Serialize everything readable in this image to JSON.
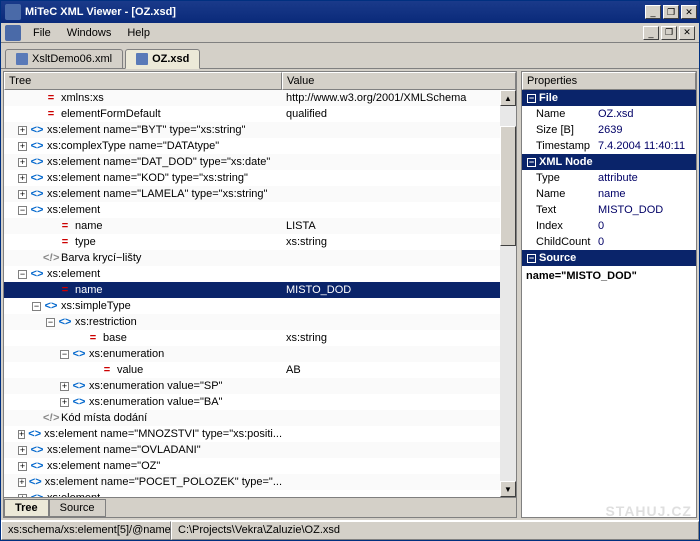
{
  "title": "MiTeC XML Viewer - [OZ.xsd]",
  "menu": {
    "file": "File",
    "windows": "Windows",
    "help": "Help"
  },
  "tabs": [
    {
      "label": "XsltDemo06.xml",
      "active": false
    },
    {
      "label": "OZ.xsd",
      "active": true
    }
  ],
  "tree_headers": {
    "tree": "Tree",
    "value": "Value"
  },
  "tree_tabs": {
    "tree": "Tree",
    "source": "Source"
  },
  "prop_header": "Properties",
  "rows": [
    {
      "indent": 2,
      "exp": "",
      "ico": "=",
      "icoc": "attr",
      "label": "xmlns:xs",
      "value": "http://www.w3.org/2001/XMLSchema",
      "sel": false
    },
    {
      "indent": 2,
      "exp": "",
      "ico": "=",
      "icoc": "attr",
      "label": "elementFormDefault",
      "value": "qualified",
      "sel": false
    },
    {
      "indent": 1,
      "exp": "+",
      "ico": "<>",
      "icoc": "elem",
      "label": "xs:element name=\"BYT\" type=\"xs:string\"",
      "value": "",
      "sel": false
    },
    {
      "indent": 1,
      "exp": "+",
      "ico": "<>",
      "icoc": "elem",
      "label": "xs:complexType name=\"DATAtype\"",
      "value": "",
      "sel": false
    },
    {
      "indent": 1,
      "exp": "+",
      "ico": "<>",
      "icoc": "elem",
      "label": "xs:element name=\"DAT_DOD\" type=\"xs:date\"",
      "value": "",
      "sel": false
    },
    {
      "indent": 1,
      "exp": "+",
      "ico": "<>",
      "icoc": "elem",
      "label": "xs:element name=\"KOD\" type=\"xs:string\"",
      "value": "",
      "sel": false
    },
    {
      "indent": 1,
      "exp": "+",
      "ico": "<>",
      "icoc": "elem",
      "label": "xs:element name=\"LAMELA\" type=\"xs:string\"",
      "value": "",
      "sel": false
    },
    {
      "indent": 1,
      "exp": "−",
      "ico": "<>",
      "icoc": "elem",
      "label": "xs:element",
      "value": "",
      "sel": false
    },
    {
      "indent": 3,
      "exp": "",
      "ico": "=",
      "icoc": "attr",
      "label": "name",
      "value": "LISTA",
      "sel": false
    },
    {
      "indent": 3,
      "exp": "",
      "ico": "=",
      "icoc": "attr",
      "label": "type",
      "value": "xs:string",
      "sel": false
    },
    {
      "indent": 2,
      "exp": "",
      "ico": "<!>",
      "icoc": "cmt",
      "label": "Barva krycí−lišty",
      "value": "",
      "sel": false
    },
    {
      "indent": 1,
      "exp": "−",
      "ico": "<>",
      "icoc": "elem",
      "label": "xs:element",
      "value": "",
      "sel": false
    },
    {
      "indent": 3,
      "exp": "",
      "ico": "=",
      "icoc": "attr",
      "label": "name",
      "value": "MISTO_DOD",
      "sel": true
    },
    {
      "indent": 2,
      "exp": "−",
      "ico": "<>",
      "icoc": "elem",
      "label": "xs:simpleType",
      "value": "",
      "sel": false
    },
    {
      "indent": 3,
      "exp": "−",
      "ico": "<>",
      "icoc": "elem",
      "label": "xs:restriction",
      "value": "",
      "sel": false
    },
    {
      "indent": 5,
      "exp": "",
      "ico": "=",
      "icoc": "attr",
      "label": "base",
      "value": "xs:string",
      "sel": false
    },
    {
      "indent": 4,
      "exp": "−",
      "ico": "<>",
      "icoc": "elem",
      "label": "xs:enumeration",
      "value": "",
      "sel": false
    },
    {
      "indent": 6,
      "exp": "",
      "ico": "=",
      "icoc": "attr",
      "label": "value",
      "value": "AB",
      "sel": false
    },
    {
      "indent": 4,
      "exp": "+",
      "ico": "<>",
      "icoc": "elem",
      "label": "xs:enumeration value=\"SP\"",
      "value": "",
      "sel": false
    },
    {
      "indent": 4,
      "exp": "+",
      "ico": "<>",
      "icoc": "elem",
      "label": "xs:enumeration value=\"BA\"",
      "value": "",
      "sel": false
    },
    {
      "indent": 2,
      "exp": "",
      "ico": "<!>",
      "icoc": "cmt",
      "label": "Kód místa dodání",
      "value": "",
      "sel": false
    },
    {
      "indent": 1,
      "exp": "+",
      "ico": "<>",
      "icoc": "elem",
      "label": "xs:element name=\"MNOZSTVI\" type=\"xs:positi...",
      "value": "",
      "sel": false
    },
    {
      "indent": 1,
      "exp": "+",
      "ico": "<>",
      "icoc": "elem",
      "label": "xs:element name=\"OVLADANI\"",
      "value": "",
      "sel": false
    },
    {
      "indent": 1,
      "exp": "+",
      "ico": "<>",
      "icoc": "elem",
      "label": "xs:element name=\"OZ\"",
      "value": "",
      "sel": false
    },
    {
      "indent": 1,
      "exp": "+",
      "ico": "<>",
      "icoc": "elem",
      "label": "xs:element name=\"POCET_POLOZEK\" type=\"...",
      "value": "",
      "sel": false
    },
    {
      "indent": 1,
      "exp": "+",
      "ico": "<>",
      "icoc": "elem",
      "label": "xs:element",
      "value": "",
      "sel": false
    }
  ],
  "properties": {
    "file_head": "File",
    "file_rows": [
      {
        "k": "Name",
        "v": "OZ.xsd"
      },
      {
        "k": "Size [B]",
        "v": "2639"
      },
      {
        "k": "Timestamp",
        "v": "7.4.2004 11:40:11"
      }
    ],
    "node_head": "XML Node",
    "node_rows": [
      {
        "k": "Type",
        "v": "attribute"
      },
      {
        "k": "Name",
        "v": "name"
      },
      {
        "k": "Text",
        "v": "MISTO_DOD"
      },
      {
        "k": "Index",
        "v": "0"
      },
      {
        "k": "ChildCount",
        "v": "0"
      }
    ],
    "source_head": "Source",
    "source_text": "name=\"MISTO_DOD\""
  },
  "status": {
    "path": "xs:schema/xs:element[5]/@name",
    "file": "C:\\Projects\\Vekra\\Zaluzie\\OZ.xsd"
  },
  "watermark": "STAHUJ.CZ"
}
